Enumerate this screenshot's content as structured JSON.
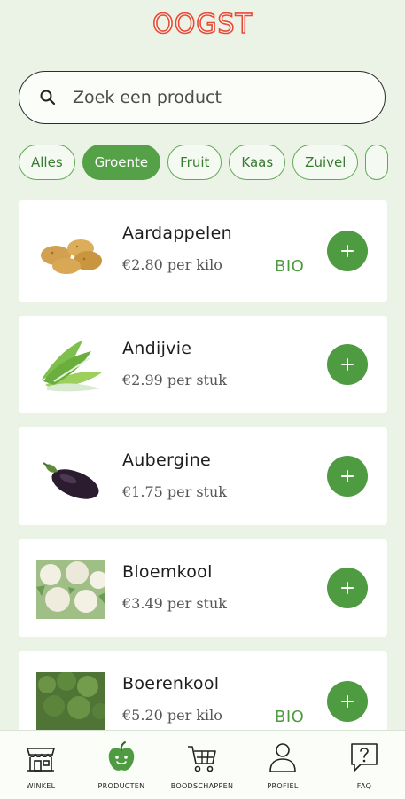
{
  "header": {
    "logo_text": "OOGST"
  },
  "search": {
    "placeholder": "Zoek een product"
  },
  "filters": [
    {
      "label": "Alles",
      "active": false
    },
    {
      "label": "Groente",
      "active": true
    },
    {
      "label": "Fruit",
      "active": false
    },
    {
      "label": "Kaas",
      "active": false
    },
    {
      "label": "Zuivel",
      "active": false
    }
  ],
  "products": [
    {
      "name": "Aardappelen",
      "price": "€2.80 per kilo",
      "badge": "BIO",
      "image": "potatoes"
    },
    {
      "name": "Andijvie",
      "price": "€2.99 per stuk",
      "badge": "",
      "image": "endive"
    },
    {
      "name": "Aubergine",
      "price": "€1.75 per stuk",
      "badge": "",
      "image": "eggplant"
    },
    {
      "name": "Bloemkool",
      "price": "€3.49 per stuk",
      "badge": "",
      "image": "cauliflower"
    },
    {
      "name": "Boerenkool",
      "price": "€5.20 per kilo",
      "badge": "BIO",
      "image": "kale"
    }
  ],
  "tabbar": [
    {
      "label": "WINKEL",
      "icon": "shop-icon"
    },
    {
      "label": "PRODUCTEN",
      "icon": "apple-icon"
    },
    {
      "label": "BOODSCHAPPEN",
      "icon": "cart-icon"
    },
    {
      "label": "PROFIEL",
      "icon": "person-icon"
    },
    {
      "label": "FAQ",
      "icon": "question-bubble-icon"
    }
  ],
  "colors": {
    "brand": "#e84a35",
    "accent": "#4e9b42",
    "background": "#eaf3e5"
  }
}
